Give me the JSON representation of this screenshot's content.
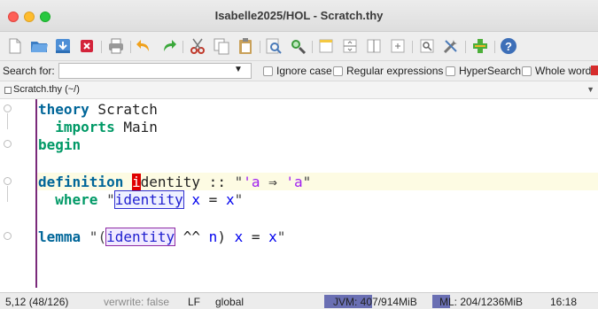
{
  "window": {
    "title": "Isabelle2025/HOL - Scratch.thy"
  },
  "toolbar": {
    "icons": [
      "new-file-icon",
      "open-folder-icon",
      "open-recent-icon",
      "close-file-icon",
      "print-icon",
      "undo-icon",
      "redo-icon",
      "cut-icon",
      "copy-icon",
      "paste-icon",
      "find-icon",
      "find-replace-icon",
      "new-view-icon",
      "split-horizontal-icon",
      "split-vertical-icon",
      "unsplit-icon",
      "buffer-options-icon",
      "global-options-icon",
      "plugin-manager-icon",
      "help-icon"
    ]
  },
  "search": {
    "label": "Search for:",
    "value": "",
    "options": [
      {
        "label": "Ignore case",
        "checked": false
      },
      {
        "label": "Regular expressions",
        "checked": false
      },
      {
        "label": "HyperSearch",
        "checked": false
      },
      {
        "label": "Whole word",
        "checked": false
      }
    ]
  },
  "tab": {
    "label": "Scratch.thy (~/)"
  },
  "code": {
    "l1_kw": "theory",
    "l1_rest": " Scratch",
    "l2_kw": "imports",
    "l2_rest": " Main",
    "l3_kw": "begin",
    "l5_kw": "definition",
    "l5_cursor": "i",
    "l5_name": "dentity",
    "l5_sep": " :: ",
    "l5_q1": "\"",
    "l5_tv1": "'a",
    "l5_arrow": " ⇒ ",
    "l5_tv2": "'a",
    "l5_q2": "\"",
    "l6_kw": "where",
    "l6_q1": " \"",
    "l6_fn": "identity",
    "l6_x1": "x",
    "l6_eq": " = ",
    "l6_x2": "x",
    "l6_q2": "\"",
    "l8_kw": "lemma",
    "l8_q1": " \"(",
    "l8_fn": "identity",
    "l8_op": " ^^ ",
    "l8_n": "n",
    "l8_paren": ")",
    "l8_x1": "x",
    "l8_eq": " = ",
    "l8_x2": "x",
    "l8_q2": "\""
  },
  "status": {
    "position": "5,12 (48/126)",
    "overwrite": "verwrite: false",
    "line_ending": "LF",
    "mode": "global",
    "jvm": "JVM: 407/914MiB",
    "jvm_fill": 0.45,
    "ml": "ML: 204/1236MiB",
    "ml_fill": 0.17,
    "clock": "16:18"
  },
  "colors": {
    "keyword": "#006699",
    "keyword2": "#009966",
    "type_var": "#a020f0",
    "free_var": "#0000ee",
    "cursor": "#e00000"
  }
}
